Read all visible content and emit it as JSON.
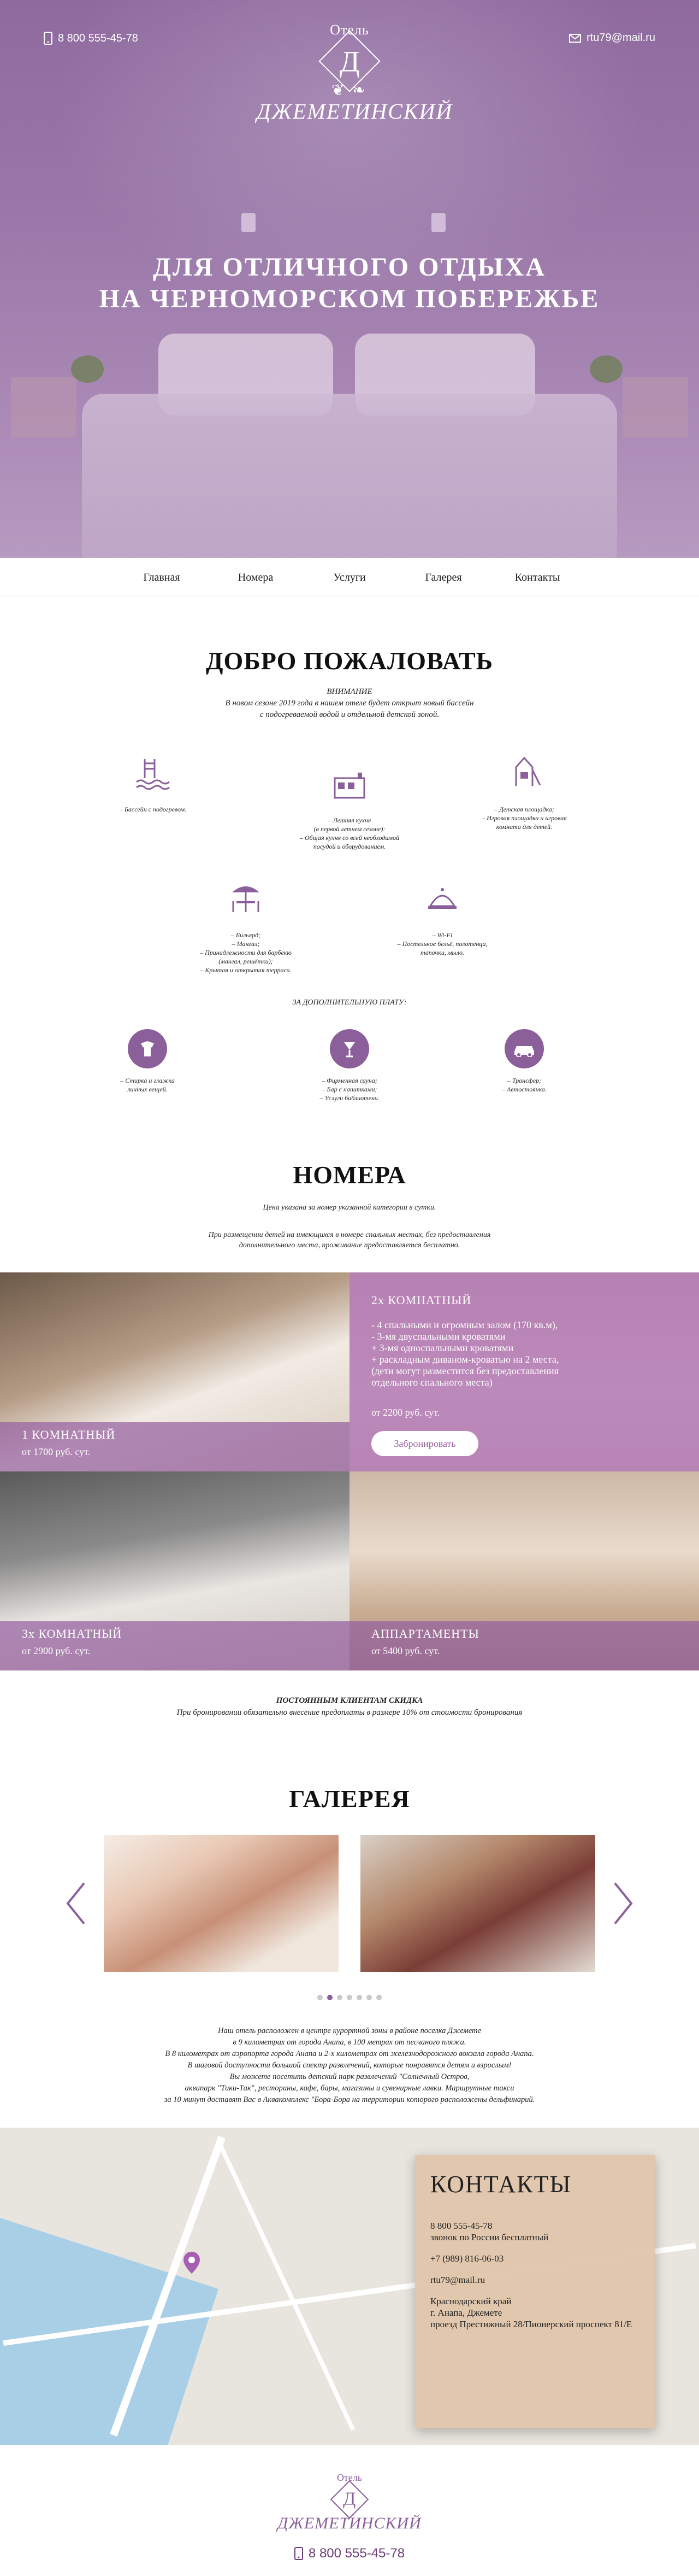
{
  "header": {
    "phone": "8 800 555-45-78",
    "email": "rtu79@mail.ru",
    "logo_small": "Отель",
    "logo_letter": "Д",
    "logo_name": "ДЖЕМЕТИНСКИЙ",
    "hero_line1": "ДЛЯ ОТЛИЧНОГО ОТДЫХА",
    "hero_line2": "НА ЧЕРНОМОРСКОМ ПОБЕРЕЖЬЕ"
  },
  "nav": [
    "Главная",
    "Номера",
    "Услуги",
    "Галерея",
    "Контакты"
  ],
  "welcome": {
    "title": "ДОБРО ПОЖАЛОВАТЬ",
    "notice_title": "ВНИМАНИЕ",
    "notice_text1": "В новом сезоне 2019 года в нашем отеле будет открыт новый бассейн",
    "notice_text2": "с подогреваемой водой и отдельной детской зоной.",
    "features": [
      {
        "icon": "pool-icon",
        "lines": [
          "– Бассейн с подогревом."
        ]
      },
      {
        "icon": "kitchen-icon",
        "lines": [
          "– Летняя кухня",
          "(в первой летнем сезоне):",
          "– Общая кухня со всей необходимой",
          "посудой и оборудованием."
        ]
      },
      {
        "icon": "playground-icon",
        "lines": [
          "– Детская площадка;",
          "– Игровая площадка и игровая",
          "комната для детей."
        ]
      },
      {
        "icon": "cafe-icon",
        "lines": [
          "– Бильярд;",
          "– Мангал;",
          "– Принадлежности для барбекю",
          "(мангал, решётки);",
          "– Крытая и открытая терраса."
        ]
      },
      {
        "icon": "service-icon",
        "lines": [
          "– Wi-Fi",
          "– Постельное бельё, полотенца,",
          "тапочки, мыло."
        ]
      }
    ],
    "extra_title": "ЗА ДОПОЛНИТЕЛЬНУЮ ПЛАТУ:",
    "extras": [
      {
        "icon": "laundry-icon",
        "lines": [
          "– Стирка и глажка",
          "личных вещей."
        ]
      },
      {
        "icon": "drinks-icon",
        "lines": [
          "– Фирменная сауна;",
          "– Бар с напитками;",
          "– Услуги библиотеки."
        ]
      },
      {
        "icon": "car-icon",
        "lines": [
          "– Трансфер;",
          "– Автостоянка."
        ]
      }
    ]
  },
  "rooms": {
    "title": "НОМЕРА",
    "note": "Цена указана за номер указанной категории в сутки.",
    "note2_line1": "При размещении детей на имеющихся в номере спальных местах, без предоставления",
    "note2_line2": "дополнительного места, проживание предоставляется бесплатно.",
    "items": [
      {
        "title": "1 КОМНАТНЫЙ",
        "price": "от 1700 руб. сут."
      },
      {
        "title": "2х КОМНАТНЫЙ",
        "price": "от 2200 руб. сут.",
        "desc": [
          "- 4 спальными и огромным залом (170 кв.м),",
          "- 3-мя двуспальными кроватями",
          "+ 3-мя односпальными кроватями",
          "+ раскладным диваном-кроватью на 2 места,",
          "(дети могут разместится без предоставления",
          "отдельного спального места)"
        ],
        "button": "Забронировать"
      },
      {
        "title": "3х КОМНАТНЫЙ",
        "price": "от 2900 руб. сут."
      },
      {
        "title": "АППАРТАМЕНТЫ",
        "price": "от 5400 руб. сут."
      }
    ],
    "discount_title": "ПОСТОЯННЫМ КЛИЕНТАМ СКИДКА",
    "discount_text": "При бронировании обязательно внесение предоплаты в размере 10% от стоимости бронирования"
  },
  "gallery": {
    "title": "ГАЛЕРЕЯ",
    "about": [
      "Наш отель расположен в центре курортной зоны в районе поселка Джемете",
      "в 9 километрах от города Анапа, в 100 метрах от песчаного пляжа.",
      "В 8 километрах от аэропорта города Анапа и 2-х километрах от железнодорожного вокзала города Анапа.",
      "В шаговой доступности большой спектр развлечений, которые понравятся детям и взрослым!",
      "Вы можете посетить детский парк развлечений \"Солнечный Остров,",
      "аквапарк \"Тики-Так\", рестораны, кафе, бары, магазины и сувенирные лавки. Маршрутные такси",
      "за 10 минут доставят Вас в Аквакомплекс \"Бора-Бора на территории которого расположены дельфинарий."
    ]
  },
  "contacts": {
    "title": "КОНТАКТЫ",
    "phone1": "8 800 555-45-78",
    "phone1_note": "звонок по России бесплатный",
    "phone2": "+7 (989) 816-06-03",
    "email": "rtu79@mail.ru",
    "addr1": "Краснодарский край",
    "addr2": "г. Анапа, Джемете",
    "addr3": "проезд Престижный 28/Пионерский проспект 81/Е"
  },
  "footer": {
    "logo_small": "Отель",
    "logo_letter": "Д",
    "logo_name": "ДЖЕМЕТИНСКИЙ",
    "phone": "8 800 555-45-78"
  }
}
